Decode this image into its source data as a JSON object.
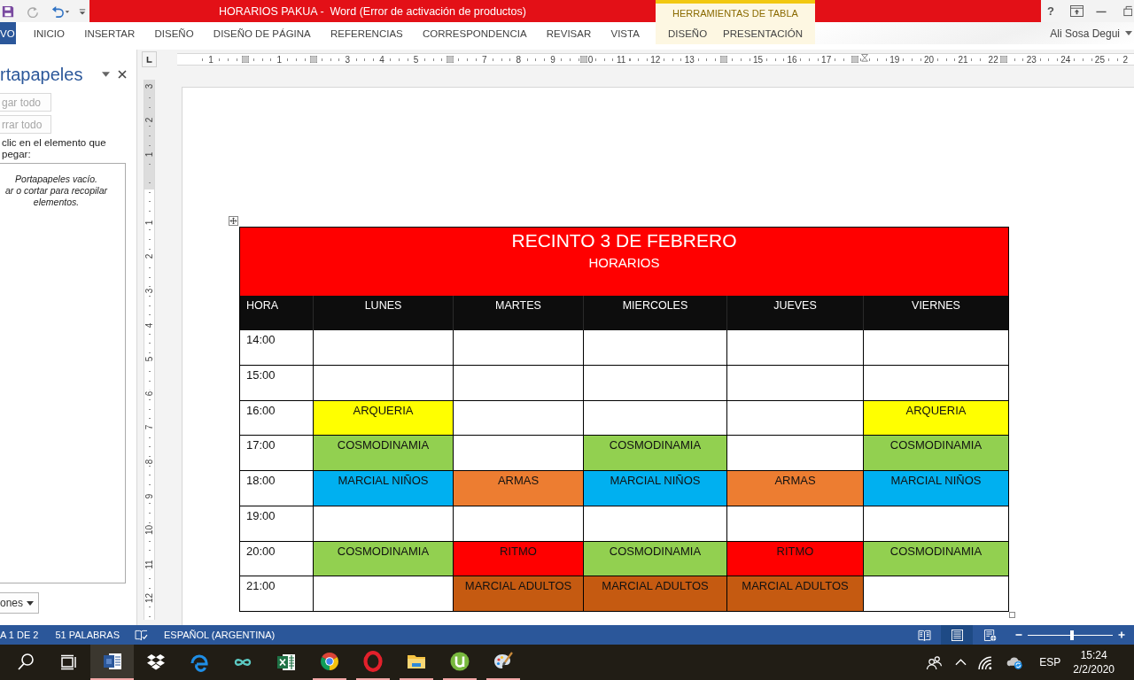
{
  "title_bar": {
    "quick_access": [
      {
        "kind": "save",
        "disabled": false
      },
      {
        "kind": "redo",
        "disabled": true
      },
      {
        "kind": "undo",
        "disabled": false
      },
      {
        "kind": "customize",
        "disabled": false
      }
    ],
    "title": "HORARIOS PAKUA -  Word (Error de activación de productos)",
    "tool_group": "HERRAMIENTAS DE TABLA",
    "help": "?"
  },
  "ribbon": {
    "tabs": [
      {
        "label": "VO",
        "kind": "file",
        "selected": false
      },
      {
        "label": "INICIO",
        "kind": "main",
        "selected": false
      },
      {
        "label": "INSERTAR",
        "kind": "main",
        "selected": false
      },
      {
        "label": "DISEÑO",
        "kind": "main",
        "selected": false
      },
      {
        "label": "DISEÑO DE PÁGINA",
        "kind": "main",
        "selected": false
      },
      {
        "label": "REFERENCIAS",
        "kind": "main",
        "selected": false
      },
      {
        "label": "CORRESPONDENCIA",
        "kind": "main",
        "selected": false
      },
      {
        "label": "REVISAR",
        "kind": "main",
        "selected": false
      },
      {
        "label": "VISTA",
        "kind": "main",
        "selected": false
      },
      {
        "label": "DISEÑO",
        "kind": "contextual",
        "selected": false
      },
      {
        "label": "PRESENTACIÓN",
        "kind": "contextual",
        "selected": false
      }
    ],
    "account": "Ali Sosa Degui"
  },
  "clipboard_pane": {
    "title": "rtapapeles",
    "buttons": [
      {
        "label": "gar todo",
        "disabled": true
      },
      {
        "label": "rrar todo",
        "disabled": true
      }
    ],
    "instruction": "clic en el elemento que\npegar:",
    "empty_message": "Portapapeles vacío.\nar o cortar para recopilar\nelementos.",
    "options_button": "ones"
  },
  "horizontal_ruler": [
    {
      "kind": "number",
      "label": "1"
    },
    {
      "kind": "marker"
    },
    {
      "kind": "number",
      "label": "1"
    },
    {
      "kind": "marker"
    },
    {
      "kind": "number",
      "label": "3"
    },
    {
      "kind": "number",
      "label": "4"
    },
    {
      "kind": "number",
      "label": "5"
    },
    {
      "kind": "marker"
    },
    {
      "kind": "number",
      "label": "7"
    },
    {
      "kind": "number",
      "label": "8"
    },
    {
      "kind": "number",
      "label": "9"
    },
    {
      "kind": "marker-number",
      "label": "0"
    },
    {
      "kind": "number",
      "label": "11"
    },
    {
      "kind": "number",
      "label": "12"
    },
    {
      "kind": "number",
      "label": "13"
    },
    {
      "kind": "marker"
    },
    {
      "kind": "number",
      "label": "15"
    },
    {
      "kind": "number",
      "label": "16"
    },
    {
      "kind": "number",
      "label": "17"
    },
    {
      "kind": "indent"
    },
    {
      "kind": "number",
      "label": "19"
    },
    {
      "kind": "number",
      "label": "20"
    },
    {
      "kind": "number",
      "label": "21"
    },
    {
      "kind": "number-marker",
      "label": "22"
    },
    {
      "kind": "number",
      "label": "23"
    },
    {
      "kind": "number",
      "label": "24"
    },
    {
      "kind": "number",
      "label": "25"
    },
    {
      "kind": "number",
      "label": "2"
    }
  ],
  "vertical_ruler": [
    {
      "kind": "number",
      "label": "3"
    },
    {
      "kind": "number",
      "label": "2"
    },
    {
      "kind": "number",
      "label": "1"
    },
    {
      "kind": "tick"
    },
    {
      "kind": "number",
      "label": "1"
    },
    {
      "kind": "number",
      "label": "2"
    },
    {
      "kind": "number",
      "label": "3"
    },
    {
      "kind": "number",
      "label": "4"
    },
    {
      "kind": "number",
      "label": "5"
    },
    {
      "kind": "number",
      "label": "6"
    },
    {
      "kind": "number",
      "label": "7"
    },
    {
      "kind": "number",
      "label": "8"
    },
    {
      "kind": "number",
      "label": "9"
    },
    {
      "kind": "number",
      "label": "10"
    },
    {
      "kind": "number",
      "label": "11"
    },
    {
      "kind": "number",
      "label": "12"
    }
  ],
  "document": {
    "table": {
      "title": "RECINTO 3 DE FEBRERO",
      "subtitle": "HORARIOS",
      "columns": [
        "HORA",
        "LUNES",
        "MARTES",
        "MIERCOLES",
        "JUEVES",
        "VIERNES"
      ],
      "rows": [
        {
          "cells": [
            {
              "text": "14:00"
            },
            {},
            {},
            {},
            {},
            {}
          ]
        },
        {
          "cells": [
            {
              "text": "15:00"
            },
            {},
            {},
            {},
            {},
            {}
          ]
        },
        {
          "cells": [
            {
              "text": "16:00"
            },
            {
              "text": "ARQUERIA",
              "color": "#ffff00"
            },
            {},
            {},
            {},
            {
              "text": "ARQUERIA",
              "color": "#ffff00"
            }
          ]
        },
        {
          "cells": [
            {
              "text": "17:00"
            },
            {
              "text": "COSMODINAMIA",
              "color": "#92d050"
            },
            {},
            {
              "text": "COSMODINAMIA",
              "color": "#92d050"
            },
            {},
            {
              "text": "COSMODINAMIA",
              "color": "#92d050"
            }
          ]
        },
        {
          "cells": [
            {
              "text": "18:00"
            },
            {
              "text": "MARCIAL NIÑOS",
              "color": "#00b0f0"
            },
            {
              "text": "ARMAS",
              "color": "#ed7d31"
            },
            {
              "text": "MARCIAL NIÑOS",
              "color": "#00b0f0"
            },
            {
              "text": "ARMAS",
              "color": "#ed7d31"
            },
            {
              "text": "MARCIAL NIÑOS",
              "color": "#00b0f0"
            }
          ]
        },
        {
          "cells": [
            {
              "text": "19:00"
            },
            {},
            {},
            {},
            {},
            {}
          ]
        },
        {
          "cells": [
            {
              "text": "20:00"
            },
            {
              "text": "COSMODINAMIA",
              "color": "#92d050"
            },
            {
              "text": "RITMO",
              "color": "#ff0000"
            },
            {
              "text": "COSMODINAMIA",
              "color": "#92d050"
            },
            {
              "text": "RITMO",
              "color": "#ff0000"
            },
            {
              "text": "COSMODINAMIA",
              "color": "#92d050"
            }
          ]
        },
        {
          "cells": [
            {
              "text": "21:00"
            },
            {},
            {
              "text": "MARCIAL ADULTOS",
              "color": "#c55a11"
            },
            {
              "text": "MARCIAL ADULTOS",
              "color": "#c55a11"
            },
            {
              "text": "MARCIAL ADULTOS",
              "color": "#c55a11"
            },
            {}
          ]
        }
      ]
    }
  },
  "status_bar": {
    "page": "A 1 DE 2",
    "words": "51 PALABRAS",
    "language": "ESPAÑOL (ARGENTINA)",
    "views": [
      {
        "kind": "read",
        "selected": false
      },
      {
        "kind": "print",
        "selected": true
      },
      {
        "kind": "web",
        "selected": false
      }
    ],
    "zoom": {
      "level": 0.52
    }
  },
  "taskbar": {
    "apps": [
      {
        "kind": "word",
        "running": true,
        "selected": true
      },
      {
        "kind": "dropbox",
        "running": false,
        "selected": false
      },
      {
        "kind": "edge",
        "running": false,
        "selected": false
      },
      {
        "kind": "infinity",
        "running": false,
        "selected": false
      },
      {
        "kind": "excel",
        "running": false,
        "selected": false
      },
      {
        "kind": "chrome",
        "running": true,
        "selected": false
      },
      {
        "kind": "opera",
        "running": true,
        "selected": false
      },
      {
        "kind": "explorer",
        "running": true,
        "selected": false
      },
      {
        "kind": "utorrent",
        "running": true,
        "selected": false
      },
      {
        "kind": "paint",
        "running": true,
        "selected": false
      }
    ],
    "language": "ESP",
    "time": "15:24",
    "date": "2/2/2020"
  }
}
